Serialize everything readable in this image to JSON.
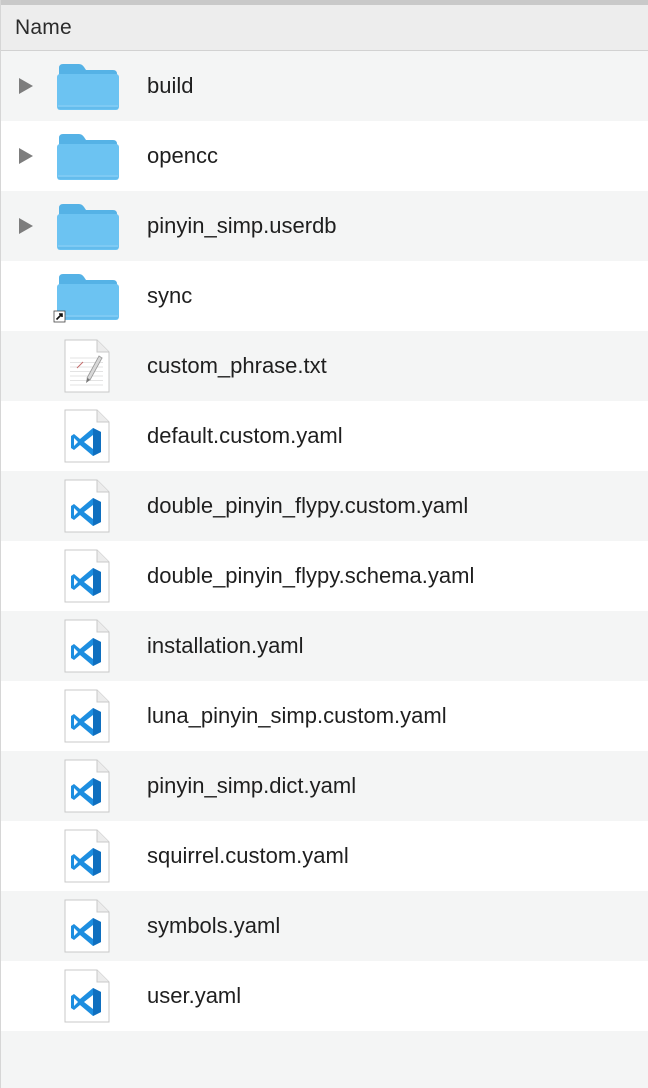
{
  "header": {
    "name_column_label": "Name"
  },
  "files": [
    {
      "name": "build",
      "kind": "folder",
      "expandable": true,
      "alias": false
    },
    {
      "name": "opencc",
      "kind": "folder",
      "expandable": true,
      "alias": false
    },
    {
      "name": "pinyin_simp.userdb",
      "kind": "folder",
      "expandable": true,
      "alias": false
    },
    {
      "name": "sync",
      "kind": "folder",
      "expandable": false,
      "alias": true
    },
    {
      "name": "custom_phrase.txt",
      "kind": "text",
      "expandable": false,
      "alias": false
    },
    {
      "name": "default.custom.yaml",
      "kind": "vscode",
      "expandable": false,
      "alias": false
    },
    {
      "name": "double_pinyin_flypy.custom.yaml",
      "kind": "vscode",
      "expandable": false,
      "alias": false
    },
    {
      "name": "double_pinyin_flypy.schema.yaml",
      "kind": "vscode",
      "expandable": false,
      "alias": false
    },
    {
      "name": "installation.yaml",
      "kind": "vscode",
      "expandable": false,
      "alias": false
    },
    {
      "name": "luna_pinyin_simp.custom.yaml",
      "kind": "vscode",
      "expandable": false,
      "alias": false
    },
    {
      "name": "pinyin_simp.dict.yaml",
      "kind": "vscode",
      "expandable": false,
      "alias": false
    },
    {
      "name": "squirrel.custom.yaml",
      "kind": "vscode",
      "expandable": false,
      "alias": false
    },
    {
      "name": "symbols.yaml",
      "kind": "vscode",
      "expandable": false,
      "alias": false
    },
    {
      "name": "user.yaml",
      "kind": "vscode",
      "expandable": false,
      "alias": false
    }
  ],
  "colors": {
    "folder": "#6cc3f2",
    "folder_dark": "#55b2e6",
    "vscode_blue": "#1d8ee0",
    "row_alt": "#f4f5f5",
    "row_white": "#ffffff"
  }
}
